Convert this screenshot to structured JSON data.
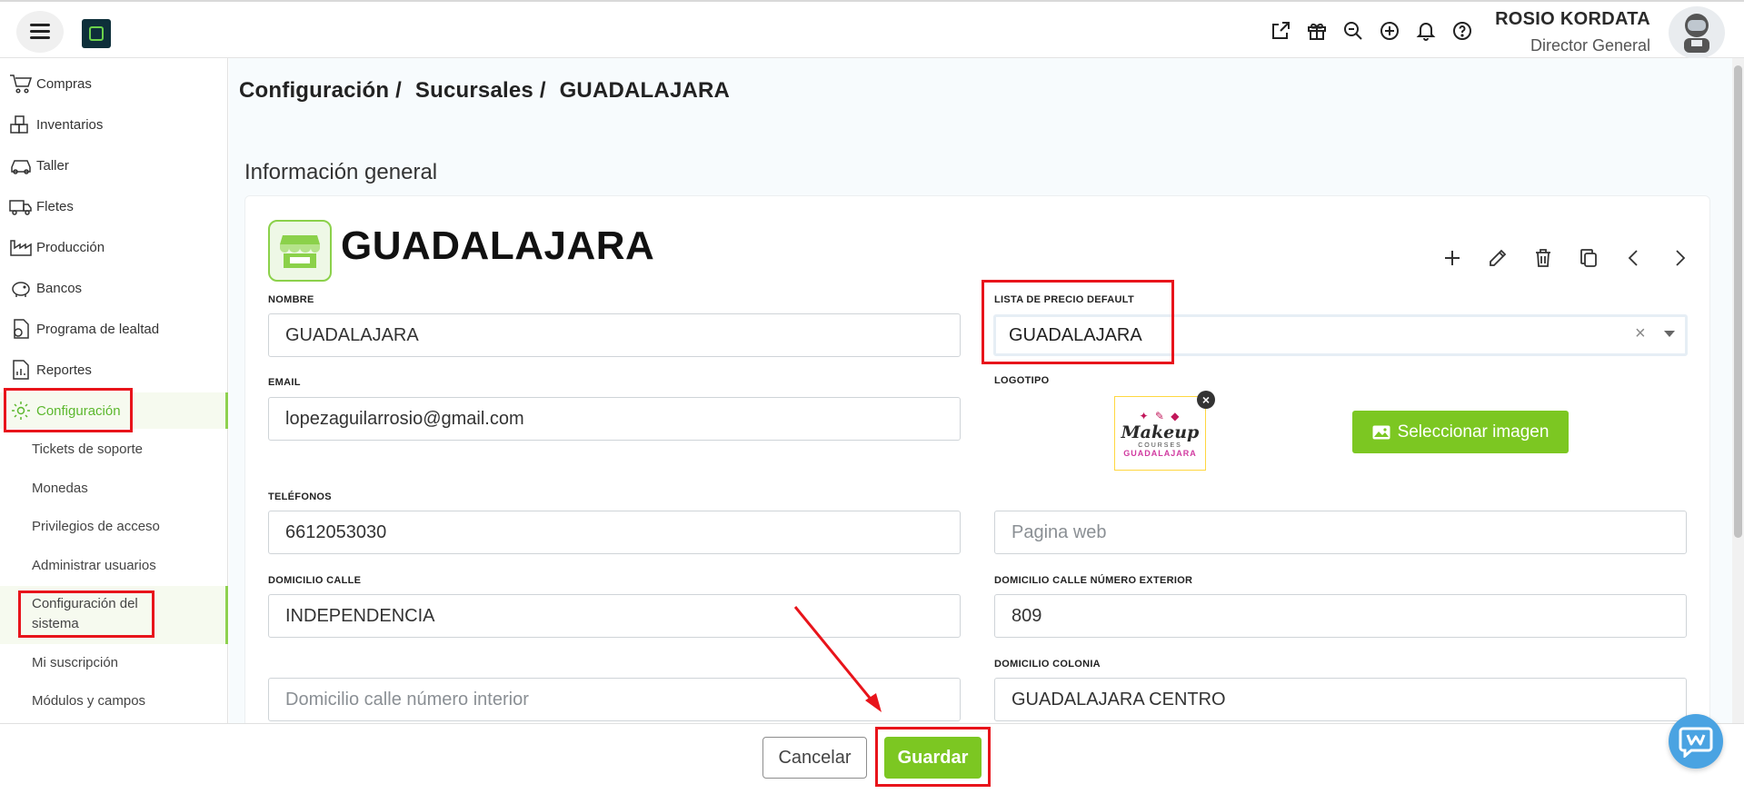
{
  "header": {
    "user_name": "ROSIO KORDATA",
    "user_role": "Director General",
    "icons": [
      "external-link-icon",
      "gift-icon",
      "search-zoom-icon",
      "plus-circle-icon",
      "bell-icon",
      "help-icon"
    ]
  },
  "sidebar": {
    "items": [
      {
        "label": "Compras",
        "icon": "cart-icon"
      },
      {
        "label": "Inventarios",
        "icon": "boxes-icon"
      },
      {
        "label": "Taller",
        "icon": "car-icon"
      },
      {
        "label": "Fletes",
        "icon": "truck-icon"
      },
      {
        "label": "Producción",
        "icon": "factory-icon"
      },
      {
        "label": "Bancos",
        "icon": "piggy-bank-icon"
      },
      {
        "label": "Programa de lealtad",
        "icon": "loyalty-icon"
      },
      {
        "label": "Reportes",
        "icon": "report-icon"
      },
      {
        "label": "Configuración",
        "icon": "gear-icon"
      }
    ],
    "sub_items": [
      "Tickets de soporte",
      "Monedas",
      "Privilegios de acceso",
      "Administrar usuarios",
      "Configuración del",
      "sistema",
      "Mi suscripción",
      "Módulos y campos"
    ]
  },
  "breadcrumb": [
    "Configuración /",
    "Sucursales /",
    "GUADALAJARA"
  ],
  "section_title": "Información general",
  "branch": {
    "title": "GUADALAJARA"
  },
  "form": {
    "nombre_label": "NOMBRE",
    "nombre_value": "GUADALAJARA",
    "lista_label": "LISTA DE PRECIO DEFAULT",
    "lista_value": "GUADALAJARA",
    "email_label": "EMAIL",
    "email_value": "lopezaguilarrosio@gmail.com",
    "logotipo_label": "LOGOTIPO",
    "select_image_label": "Seleccionar imagen",
    "telefonos_label": "TELÉFONOS",
    "telefonos_value": "6612053030",
    "pagina_web_placeholder": "Pagina web",
    "calle_label": "DOMICILIO CALLE",
    "calle_value": "INDEPENDENCIA",
    "num_ext_label": "DOMICILIO CALLE NÚMERO EXTERIOR",
    "num_ext_value": "809",
    "num_int_placeholder": "Domicilio calle número interior",
    "colonia_label": "DOMICILIO COLONIA",
    "colonia_value": "GUADALAJARA CENTRO"
  },
  "logo": {
    "line1": "Makeup",
    "line2": "COURSES",
    "line3": "GUADALAJARA"
  },
  "footer": {
    "cancel_label": "Cancelar",
    "save_label": "Guardar"
  },
  "colors": {
    "accent_green": "#7cc722",
    "annotation_red": "#e8141b",
    "chat_blue": "#4aa3e2"
  }
}
